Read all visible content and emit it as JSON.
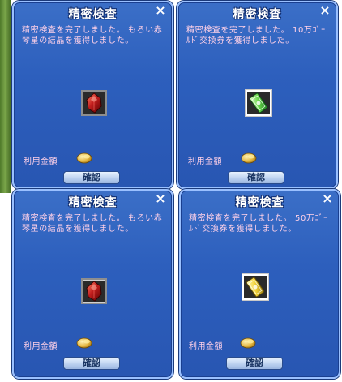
{
  "dialogs": [
    {
      "title": "精密検査",
      "close": "×",
      "message": "精密検査を完了しました。 もろい赤琴星の結晶を獲得しました。",
      "item_icon": "red-crystal-icon",
      "cost_label": "利用金額",
      "coin_icon": "gold-coin-icon",
      "confirm_label": "確認"
    },
    {
      "title": "精密検査",
      "close": "×",
      "message": "精密検査を完了しました。 10万ｺﾞｰﾙﾄﾞ交換券を獲得しました。",
      "item_icon": "green-gold-ticket-icon",
      "cost_label": "利用金額",
      "coin_icon": "gold-coin-icon",
      "confirm_label": "確認"
    },
    {
      "title": "精密検査",
      "close": "×",
      "message": "精密検査を完了しました。 もろい赤琴星の結晶を獲得しました。",
      "item_icon": "red-crystal-icon",
      "cost_label": "利用金額",
      "coin_icon": "gold-coin-icon",
      "confirm_label": "確認"
    },
    {
      "title": "精密検査",
      "close": "×",
      "message": "精密検査を完了しました。 50万ｺﾞｰﾙﾄﾞ交換券を獲得しました。",
      "item_icon": "yellow-gold-ticket-icon",
      "cost_label": "利用金額",
      "coin_icon": "gold-coin-icon",
      "confirm_label": "確認"
    }
  ],
  "colors": {
    "panel_blue": "#2d5fbd",
    "border_light": "#9ac0ff",
    "message_pink": "#ffd1e8"
  }
}
